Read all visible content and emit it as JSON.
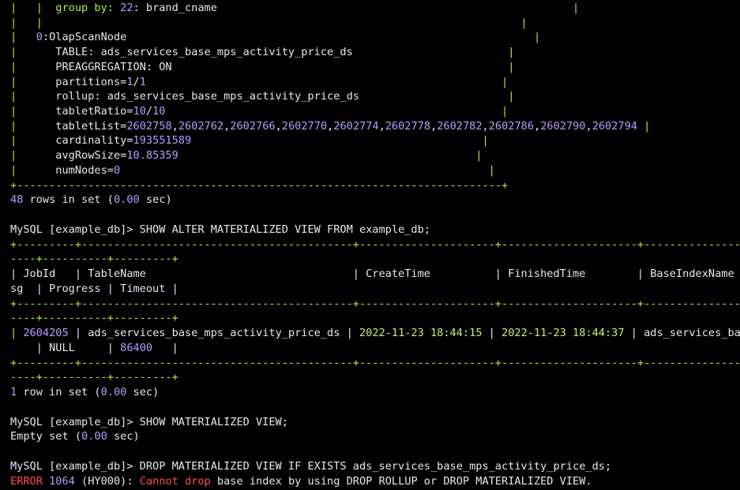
{
  "terminal": {
    "colors": {
      "background": "#000000",
      "text": "#e8e8e8",
      "number": "#b99bff",
      "border": "#aef03a",
      "date": "#c8f06a",
      "error": "#ff4d4d"
    },
    "lines": [
      {
        "segments": [
          {
            "t": "|   |  group by: ",
            "c": "border-mixed"
          },
          {
            "t": "22",
            "c": "number"
          },
          {
            "t": ": brand_cname",
            "c": "default"
          },
          {
            "t": "                                                       |",
            "c": "border"
          }
        ]
      },
      {
        "segments": [
          {
            "t": "|   |",
            "c": "border"
          },
          {
            "t": "                                                                          |",
            "c": "border"
          }
        ]
      },
      {
        "segments": [
          {
            "t": "|   ",
            "c": "border"
          },
          {
            "t": "0",
            "c": "number"
          },
          {
            "t": ":OlapScanNode",
            "c": "default"
          },
          {
            "t": "                                                               |",
            "c": "border"
          }
        ]
      },
      {
        "segments": [
          {
            "t": "|      ",
            "c": "border"
          },
          {
            "t": "TABLE: ads_services_base_mps_activity_price_ds",
            "c": "default"
          },
          {
            "t": "                        |",
            "c": "border"
          }
        ]
      },
      {
        "segments": [
          {
            "t": "|      ",
            "c": "border"
          },
          {
            "t": "PREAGGREGATION: ON",
            "c": "default"
          },
          {
            "t": "                                                    |",
            "c": "border"
          }
        ]
      },
      {
        "segments": [
          {
            "t": "|      ",
            "c": "border"
          },
          {
            "t": "partitions=",
            "c": "default"
          },
          {
            "t": "1",
            "c": "number"
          },
          {
            "t": "/",
            "c": "default"
          },
          {
            "t": "1",
            "c": "number"
          },
          {
            "t": "                                                       |",
            "c": "border"
          }
        ]
      },
      {
        "segments": [
          {
            "t": "|      ",
            "c": "border"
          },
          {
            "t": "rollup: ads_services_base_mps_activity_price_ds",
            "c": "default"
          },
          {
            "t": "                       |",
            "c": "border"
          }
        ]
      },
      {
        "segments": [
          {
            "t": "|      ",
            "c": "border"
          },
          {
            "t": "tabletRatio=",
            "c": "default"
          },
          {
            "t": "10",
            "c": "number"
          },
          {
            "t": "/",
            "c": "default"
          },
          {
            "t": "10",
            "c": "number"
          },
          {
            "t": "                                                    |",
            "c": "border"
          }
        ]
      },
      {
        "segments": [
          {
            "t": "|      ",
            "c": "border"
          },
          {
            "t": "tabletList=",
            "c": "default"
          },
          {
            "t": "2602758",
            "c": "number"
          },
          {
            "t": ",",
            "c": "default"
          },
          {
            "t": "2602762",
            "c": "number"
          },
          {
            "t": ",",
            "c": "default"
          },
          {
            "t": "2602766",
            "c": "number"
          },
          {
            "t": ",",
            "c": "default"
          },
          {
            "t": "2602770",
            "c": "number"
          },
          {
            "t": ",",
            "c": "default"
          },
          {
            "t": "2602774",
            "c": "number"
          },
          {
            "t": ",",
            "c": "default"
          },
          {
            "t": "2602778",
            "c": "number"
          },
          {
            "t": ",",
            "c": "default"
          },
          {
            "t": "2602782",
            "c": "number"
          },
          {
            "t": ",",
            "c": "default"
          },
          {
            "t": "2602786",
            "c": "number"
          },
          {
            "t": ",",
            "c": "default"
          },
          {
            "t": "2602790",
            "c": "number"
          },
          {
            "t": ",",
            "c": "default"
          },
          {
            "t": "2602794",
            "c": "number"
          },
          {
            "t": " |",
            "c": "border"
          }
        ]
      },
      {
        "segments": [
          {
            "t": "|      ",
            "c": "border"
          },
          {
            "t": "cardinality=",
            "c": "default"
          },
          {
            "t": "193551589",
            "c": "number"
          },
          {
            "t": "                                             |",
            "c": "border"
          }
        ]
      },
      {
        "segments": [
          {
            "t": "|      ",
            "c": "border"
          },
          {
            "t": "avgRowSize=",
            "c": "default"
          },
          {
            "t": "10.85359",
            "c": "number"
          },
          {
            "t": "                                              |",
            "c": "border"
          }
        ]
      },
      {
        "segments": [
          {
            "t": "|      ",
            "c": "border"
          },
          {
            "t": "numNodes=",
            "c": "default"
          },
          {
            "t": "0",
            "c": "number"
          },
          {
            "t": "                                                         |",
            "c": "border"
          }
        ]
      },
      {
        "segments": [
          {
            "t": "+---------------------------------------------------------------------------+",
            "c": "border"
          }
        ]
      },
      {
        "segments": [
          {
            "t": "48",
            "c": "number"
          },
          {
            "t": " rows in set (",
            "c": "default"
          },
          {
            "t": "0.00",
            "c": "number"
          },
          {
            "t": " sec)",
            "c": "default"
          }
        ]
      },
      {
        "segments": [
          {
            "t": "",
            "c": "default"
          }
        ]
      },
      {
        "segments": [
          {
            "t": "MySQL [example_db]> SHOW ALTER MATERIALIZED VIEW FROM example_db;",
            "c": "default"
          }
        ]
      },
      {
        "segments": [
          {
            "t": "+---------+------------------------------------------+---------------------+---------------------+-------------------",
            "c": "border"
          }
        ]
      },
      {
        "segments": [
          {
            "t": "----+----------+---------+",
            "c": "border"
          }
        ]
      },
      {
        "segments": [
          {
            "t": "| JobId   | TableName                                | CreateTime          | FinishedTime        | BaseIndexName",
            "c": "default"
          }
        ]
      },
      {
        "segments": [
          {
            "t": "sg  | Progress | Timeout |",
            "c": "default"
          }
        ]
      },
      {
        "segments": [
          {
            "t": "+---------+------------------------------------------+---------------------+---------------------+-------------------",
            "c": "border"
          }
        ]
      },
      {
        "segments": [
          {
            "t": "----+----------+---------+",
            "c": "border"
          }
        ]
      },
      {
        "segments": [
          {
            "t": "| ",
            "c": "border"
          },
          {
            "t": "2604205",
            "c": "number"
          },
          {
            "t": " | ads_services_base_mps_activity_price_ds | ",
            "c": "default"
          },
          {
            "t": "2022-11-23 18:44:15",
            "c": "date"
          },
          {
            "t": " | ",
            "c": "default"
          },
          {
            "t": "2022-11-23 18:44:37",
            "c": "date"
          },
          {
            "t": " | ads_services_ba",
            "c": "default"
          }
        ]
      },
      {
        "segments": [
          {
            "t": "    | NULL     | ",
            "c": "default"
          },
          {
            "t": "86400",
            "c": "number"
          },
          {
            "t": "   |",
            "c": "default"
          }
        ]
      },
      {
        "segments": [
          {
            "t": "+---------+------------------------------------------+---------------------+---------------------+-------------------",
            "c": "border"
          }
        ]
      },
      {
        "segments": [
          {
            "t": "----+----------+---------+",
            "c": "border"
          }
        ]
      },
      {
        "segments": [
          {
            "t": "1",
            "c": "number"
          },
          {
            "t": " row in set (",
            "c": "default"
          },
          {
            "t": "0.00",
            "c": "number"
          },
          {
            "t": " sec)",
            "c": "default"
          }
        ]
      },
      {
        "segments": [
          {
            "t": "",
            "c": "default"
          }
        ]
      },
      {
        "segments": [
          {
            "t": "MySQL [example_db]> SHOW MATERIALIZED VIEW;",
            "c": "default"
          }
        ]
      },
      {
        "segments": [
          {
            "t": "Empty set (",
            "c": "default"
          },
          {
            "t": "0.00",
            "c": "number"
          },
          {
            "t": " sec)",
            "c": "default"
          }
        ]
      },
      {
        "segments": [
          {
            "t": "",
            "c": "default"
          }
        ]
      },
      {
        "segments": [
          {
            "t": "MySQL [example_db]> DROP MATERIALIZED VIEW IF EXISTS ads_services_base_mps_activity_price_ds;",
            "c": "default"
          }
        ]
      },
      {
        "segments": [
          {
            "t": "ERROR",
            "c": "error"
          },
          {
            "t": " ",
            "c": "default"
          },
          {
            "t": "1064",
            "c": "number"
          },
          {
            "t": " (HY000): ",
            "c": "default"
          },
          {
            "t": "Cannot drop",
            "c": "error"
          },
          {
            "t": " base index by using DROP ROLLUP or DROP MATERIALIZED VIEW.",
            "c": "default"
          }
        ]
      }
    ]
  }
}
